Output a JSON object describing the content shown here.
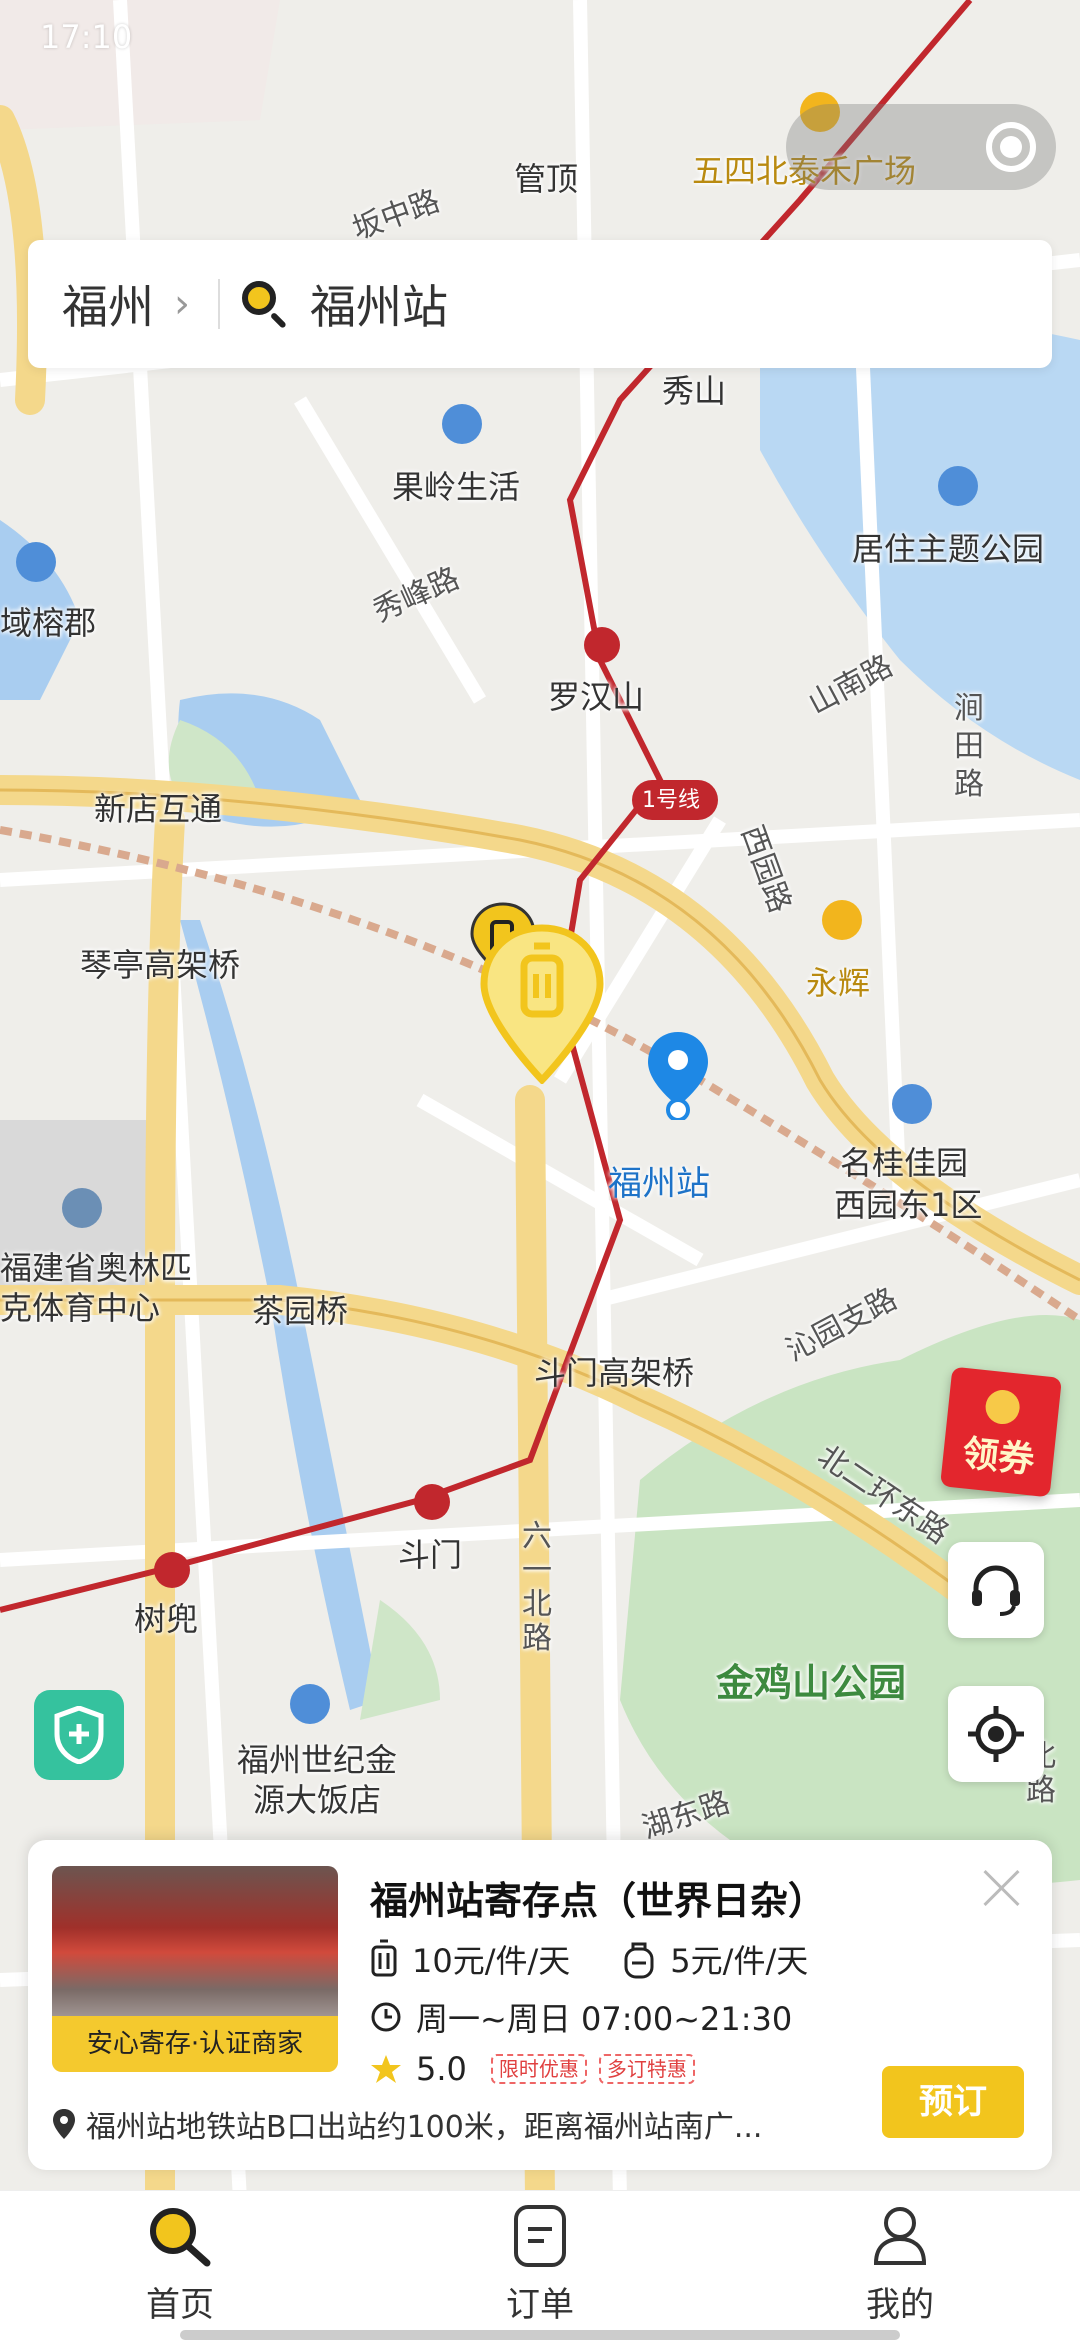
{
  "status_bar": {
    "time": "17:10"
  },
  "search": {
    "city": "福州",
    "query": "福州站"
  },
  "map": {
    "labels": {
      "guanding": "管顶",
      "banzhonglu": "坂中路",
      "wusibei": "五四北泰禾广场",
      "xiushan": "秀山",
      "guolingshenghuo": "果岭生活",
      "juzhu": "居住主题公园",
      "yurongjun": "域榕郡",
      "xiufenglu": "秀峰路",
      "luohanshan": "罗汉山",
      "shannanlu": "山南路",
      "jiantianlu": "涧田路",
      "xindianhutong": "新店互通",
      "line1": "1号线",
      "xiyuanlu": "西园路",
      "qintinggaojia": "琴亭高架桥",
      "yonghui": "永辉",
      "fuzhouzhan": "福州站",
      "mingguijiayuan": "名桂佳园",
      "xiyuandong": "西园东1区",
      "aolinpike": "福建省奥林匹克体育中心",
      "chayuanqiao": "茶园桥",
      "doumengaojia": "斗门高架桥",
      "qinyuanzhilu": "沁园支路",
      "beierhuandong": "北二环东路",
      "doumen": "斗门",
      "shudou": "树兜",
      "liuyibeilu": "六一北路",
      "jinjishan": "金鸡山公园",
      "shijijinyuan": "福州世纪金源大饭店",
      "hudonglu": "湖东路",
      "beilu": "北路"
    }
  },
  "buttons": {
    "coupon": "领券"
  },
  "store": {
    "name": "福州站寄存点（世界日杂）",
    "thumb_badge": "安心寄存·认证商家",
    "large_price": "10元/件/天",
    "small_price": "5元/件/天",
    "hours": "周一~周日 07:00~21:30",
    "rating": "5.0",
    "tag1": "限时优惠",
    "tag2": "多订特惠",
    "address": "福州站地铁站B口出站约100米，距离福州站南广...",
    "book": "预订"
  },
  "tabs": {
    "home": "首页",
    "orders": "订单",
    "mine": "我的"
  },
  "colors": {
    "brand_yellow": "#f2c51d",
    "metro_red": "#c1272d",
    "station_blue": "#1e88e5"
  }
}
